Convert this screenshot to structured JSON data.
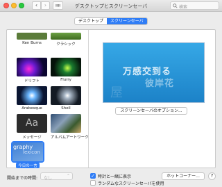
{
  "window": {
    "title": "デスクトップとスクリーンセーバ"
  },
  "search": {
    "placeholder": "検索"
  },
  "tabs": {
    "desktop": "デスクトップ",
    "screensaver": "スクリーンセーバ"
  },
  "savers": [
    {
      "label": "Ken Burns"
    },
    {
      "label": "クラシック"
    },
    {
      "label": "ドリフト"
    },
    {
      "label": "Flurry"
    },
    {
      "label": "Arabesque"
    },
    {
      "label": "Shell"
    },
    {
      "label": "メッセージ",
      "thumb_text": "Aa"
    },
    {
      "label": "アルバムアートワーク"
    },
    {
      "label": "今日の一言",
      "thumb_text": "graphy",
      "thumb_sub": "lexicon"
    }
  ],
  "preview": {
    "line1": "万感交到る",
    "line2": "彼岸花",
    "ghost": "屋"
  },
  "options_button": "スクリーンセーバのオプション...",
  "start": {
    "label": "開始までの時間:",
    "value": "なし"
  },
  "show_clock": {
    "label": "時計と一緒に表示",
    "checked": true
  },
  "random": {
    "label": "ランダムなスクリーンセーバを使用",
    "checked": false
  },
  "hot_corners": "ホットコーナー...",
  "help": "?"
}
